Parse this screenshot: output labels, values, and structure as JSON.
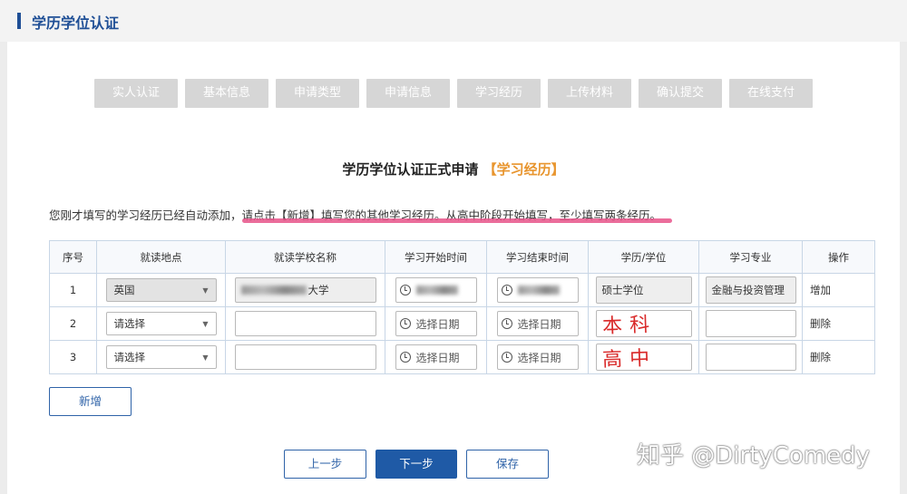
{
  "header": {
    "title": "学历学位认证"
  },
  "steps": [
    "实人认证",
    "基本信息",
    "申请类型",
    "申请信息",
    "学习经历",
    "上传材料",
    "确认提交",
    "在线支付"
  ],
  "heading": {
    "main": "学历学位认证正式申请",
    "highlight": "【学习经历】"
  },
  "notice": {
    "prefix": "您刚才填写的学习经历已经自动添加，",
    "emphasis": "请点击【新增】填写您的其他学习经历。从高中阶段开始填写，至少填写两条经历。"
  },
  "table": {
    "headers": [
      "序号",
      "就读地点",
      "就读学校名称",
      "学习开始时间",
      "学习结束时间",
      "学历/学位",
      "学习专业",
      "操作"
    ],
    "rows": [
      {
        "no": "1",
        "location": "英国",
        "school_suffix": "大学",
        "degree": "硕士学位",
        "major": "金融与投资管理",
        "action": "增加"
      },
      {
        "no": "2",
        "location": "请选择",
        "start": "选择日期",
        "end": "选择日期",
        "handwritten": "本科",
        "action": "删除"
      },
      {
        "no": "3",
        "location": "请选择",
        "start": "选择日期",
        "end": "选择日期",
        "handwritten": "高中",
        "action": "删除"
      }
    ]
  },
  "buttons": {
    "add": "新增",
    "prev": "上一步",
    "next": "下一步",
    "save": "保存"
  },
  "watermark": "知乎 @DirtyComedy",
  "colors": {
    "brand": "#1f4f96",
    "highlight": "#e8952e",
    "handwriting": "#d92a2a",
    "underline": "#e8548a"
  }
}
